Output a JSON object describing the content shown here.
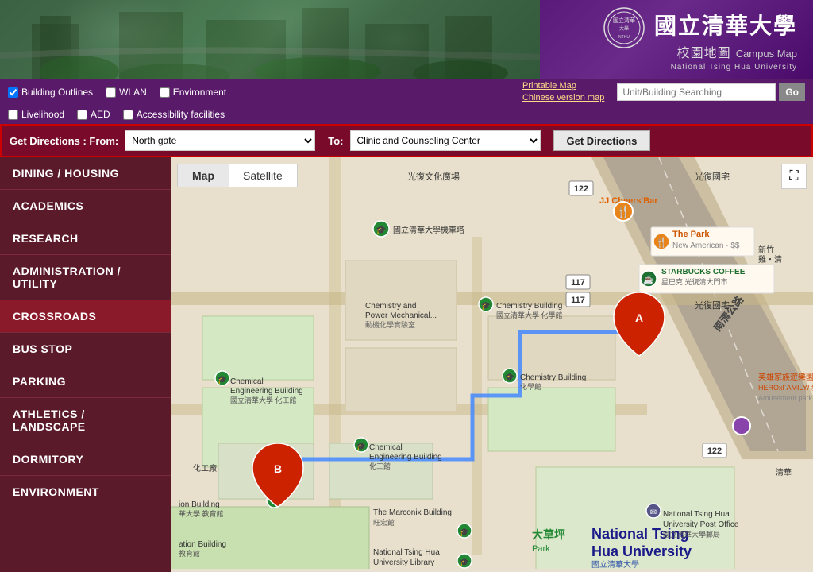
{
  "header": {
    "logo_chinese": "國立清華大學",
    "logo_campus": "校園地圖",
    "logo_english": "Campus Map",
    "logo_sub_english": "National Tsing Hua University"
  },
  "toolbar": {
    "checkboxes": [
      {
        "label": "Building Outlines",
        "checked": true
      },
      {
        "label": "WLAN",
        "checked": false
      },
      {
        "label": "Environment",
        "checked": false
      },
      {
        "label": "Livelihood",
        "checked": false
      },
      {
        "label": "AED",
        "checked": false
      },
      {
        "label": "Accessibility facilities",
        "checked": false
      }
    ],
    "links": [
      {
        "label": "Printable Map"
      },
      {
        "label": "Chinese version map"
      }
    ],
    "search_placeholder": "Unit/Building Searching",
    "search_btn_label": "Go"
  },
  "directions": {
    "label": "Get Directions : From:",
    "from_value": "North gate",
    "to_label": "To:",
    "to_value": "Clinic and Counseling Center",
    "btn_label": "Get Directions"
  },
  "sidebar": {
    "items": [
      {
        "label": "DINING / HOUSING"
      },
      {
        "label": "ACADEMICS"
      },
      {
        "label": "RESEARCH"
      },
      {
        "label": "ADMINISTRATION / UTILITY"
      },
      {
        "label": "CROSSROADS"
      },
      {
        "label": "BUS STOP"
      },
      {
        "label": "PARKING"
      },
      {
        "label": "ATHLETICS / LANDSCAPE"
      },
      {
        "label": "DORMITORY"
      },
      {
        "label": "ENVIRONMENT"
      }
    ]
  },
  "map": {
    "tab_map": "Map",
    "tab_satellite": "Satellite",
    "fullscreen_icon": "⛶",
    "markers": [
      {
        "id": "A",
        "label": "A"
      },
      {
        "id": "B",
        "label": "B"
      }
    ],
    "road_badges": [
      {
        "label": "122"
      },
      {
        "label": "117"
      },
      {
        "label": "117"
      }
    ],
    "poi_labels": [
      {
        "text": "光復文化廣場"
      },
      {
        "text": "JJ Cheers' Bar"
      },
      {
        "text": "光復國宅"
      },
      {
        "text": "The Park\nNew American · $$"
      },
      {
        "text": "STARBUCKS COFFEE\n星巴克 光復清大門市"
      },
      {
        "text": "光復國宅"
      },
      {
        "text": "新竹\n雞‧清"
      },
      {
        "text": "英雄家族遊樂園\nHEROxFAMILY/ 新\nAmusement park"
      },
      {
        "text": "Chemistry and\nPower Mechanical...\n動機化學實驗室"
      },
      {
        "text": "Chemistry Building\n國立清華大學 化學館"
      },
      {
        "text": "Chemistry Building\n化學館"
      },
      {
        "text": "Chemical\nEngineering Building\n國立清華大學 化工館"
      },
      {
        "text": "Chemical\nEngineering Building\n化工館"
      },
      {
        "text": "化工廠"
      },
      {
        "text": "ion Building\n華大學 教育館"
      },
      {
        "text": "ation Building\n教育館"
      },
      {
        "text": "The Marconix Building\n旺宏館"
      },
      {
        "text": "National Tsing Hua\nUniversity Library\n國立清華大學圖書館"
      },
      {
        "text": "大草坪\nPark"
      },
      {
        "text": "National Tsing\nHua University\n國立清華大學"
      },
      {
        "text": "National Tsing Hua\nUniversity Post Office\n國立清華大學郵局"
      },
      {
        "text": "清華"
      }
    ]
  }
}
